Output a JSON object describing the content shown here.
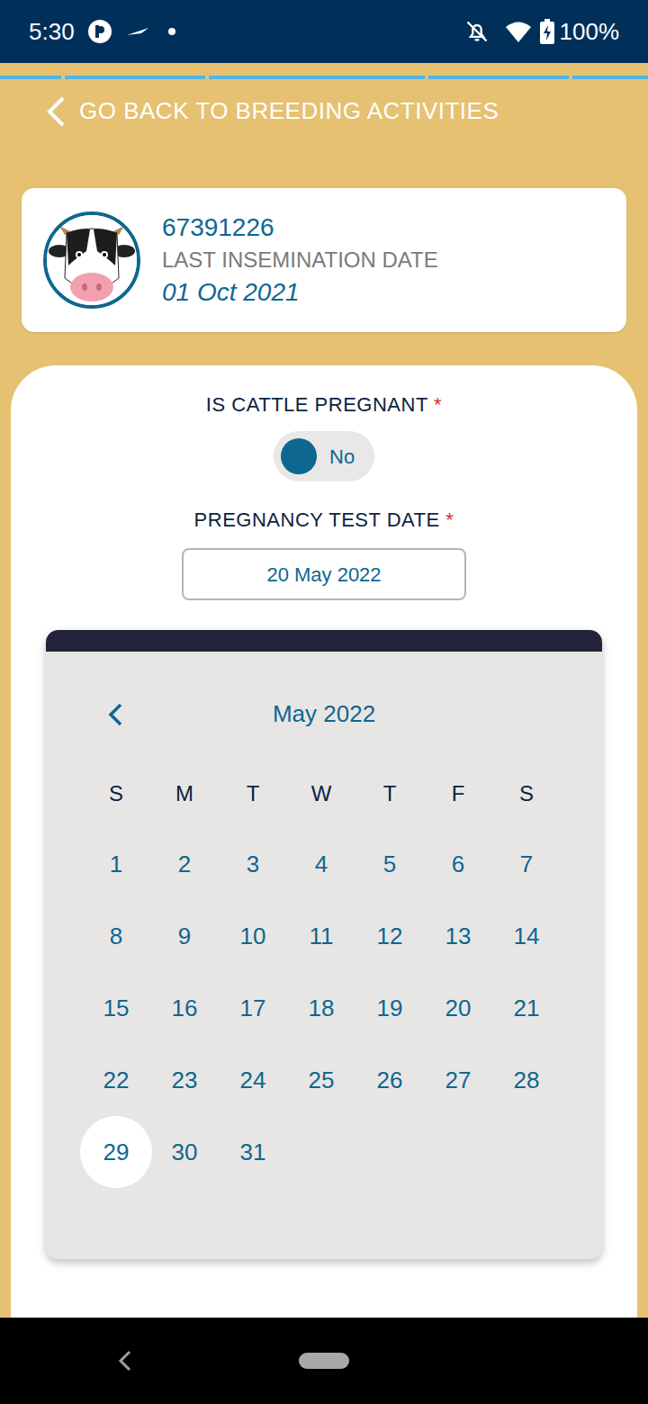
{
  "status_bar": {
    "time": "5:30",
    "battery": "100%"
  },
  "back_link": {
    "label": "GO BACK TO BREEDING ACTIVITIES"
  },
  "cattle": {
    "id": "67391226",
    "date_label": "LAST INSEMINATION DATE",
    "date": "01 Oct 2021"
  },
  "pregnant_field": {
    "label": "IS CATTLE PREGNANT",
    "required": "*",
    "value": "No",
    "on": false
  },
  "test_date_field": {
    "label": "PREGNANCY TEST DATE",
    "required": "*",
    "value": "20 May 2022"
  },
  "calendar": {
    "month": "May 2022",
    "weekdays": [
      "S",
      "M",
      "T",
      "W",
      "T",
      "F",
      "S"
    ],
    "days": [
      {
        "label": "1",
        "selected": false
      },
      {
        "label": "2",
        "selected": false
      },
      {
        "label": "3",
        "selected": false
      },
      {
        "label": "4",
        "selected": false
      },
      {
        "label": "5",
        "selected": false
      },
      {
        "label": "6",
        "selected": false
      },
      {
        "label": "7",
        "selected": false
      },
      {
        "label": "8",
        "selected": false
      },
      {
        "label": "9",
        "selected": false
      },
      {
        "label": "10",
        "selected": false
      },
      {
        "label": "11",
        "selected": false
      },
      {
        "label": "12",
        "selected": false
      },
      {
        "label": "13",
        "selected": false
      },
      {
        "label": "14",
        "selected": false
      },
      {
        "label": "15",
        "selected": false
      },
      {
        "label": "16",
        "selected": false
      },
      {
        "label": "17",
        "selected": false
      },
      {
        "label": "18",
        "selected": false
      },
      {
        "label": "19",
        "selected": false
      },
      {
        "label": "20",
        "selected": false
      },
      {
        "label": "21",
        "selected": false
      },
      {
        "label": "22",
        "selected": false
      },
      {
        "label": "23",
        "selected": false
      },
      {
        "label": "24",
        "selected": false
      },
      {
        "label": "25",
        "selected": false
      },
      {
        "label": "26",
        "selected": false
      },
      {
        "label": "27",
        "selected": false
      },
      {
        "label": "28",
        "selected": false
      },
      {
        "label": "29",
        "selected": true
      },
      {
        "label": "30",
        "selected": false
      },
      {
        "label": "31",
        "selected": false
      }
    ]
  }
}
